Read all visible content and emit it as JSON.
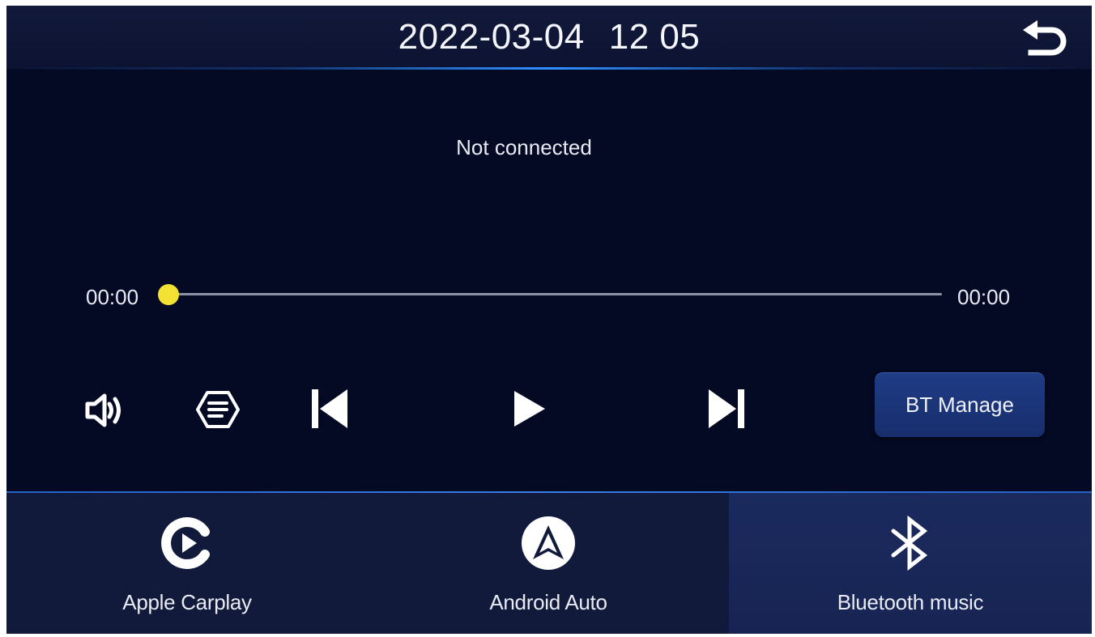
{
  "header": {
    "date": "2022-03-04",
    "time": "12 05",
    "back_icon": "back-arrow-icon"
  },
  "player": {
    "status": "Not connected",
    "elapsed": "00:00",
    "duration": "00:00",
    "progress_fraction": 0.0
  },
  "controls": {
    "volume_icon": "volume-icon",
    "playlist_icon": "list-icon",
    "previous_icon": "skip-previous-icon",
    "play_icon": "play-icon",
    "next_icon": "skip-next-icon",
    "bt_manage_label": "BT Manage"
  },
  "tabs": [
    {
      "label": "Apple Carplay",
      "icon": "carplay-icon",
      "active": false
    },
    {
      "label": "Android Auto",
      "icon": "android-auto-icon",
      "active": false
    },
    {
      "label": "Bluetooth music",
      "icon": "bluetooth-icon",
      "active": true
    }
  ],
  "colors": {
    "background": "#040a24",
    "header": "#12193a",
    "accent_line": "#2f8fff",
    "progress_knob": "#f3e233",
    "button": "#1f3c86",
    "tabbar": "#121a3b",
    "tab_active": "#1b2a5e"
  }
}
